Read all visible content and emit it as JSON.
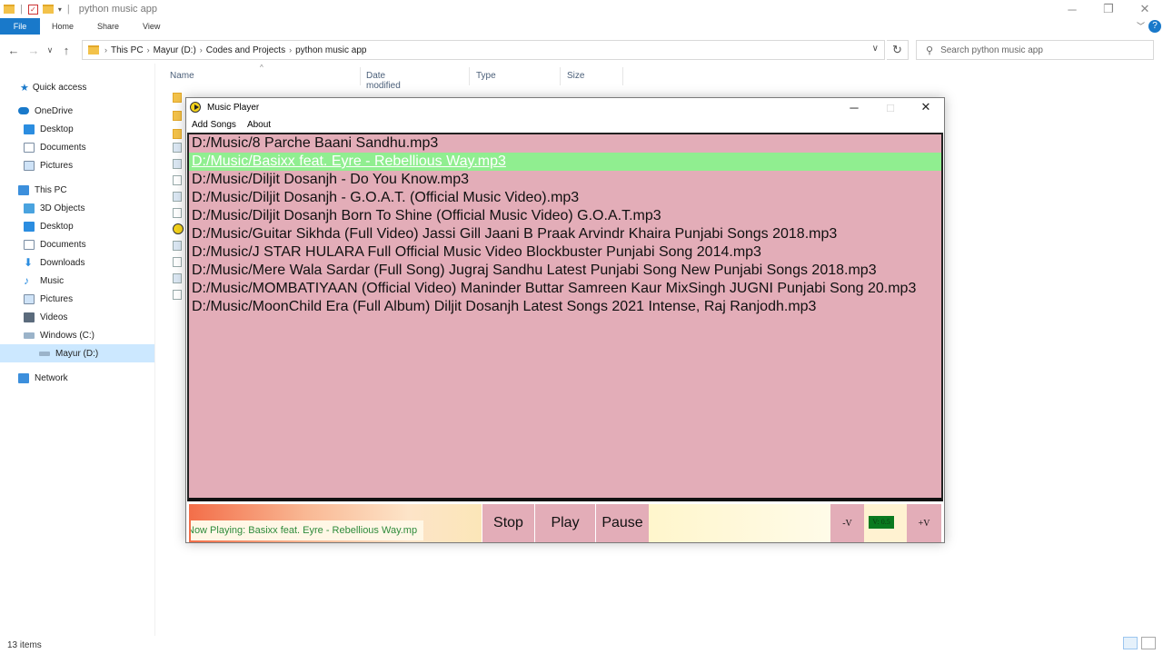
{
  "explorer": {
    "title": "python music app",
    "ribbon_tabs": [
      "File",
      "Home",
      "Share",
      "View"
    ],
    "breadcrumb": [
      "This PC",
      "Mayur (D:)",
      "Codes and Projects",
      "python music app"
    ],
    "search_placeholder": "Search python music app",
    "columns": [
      "Name",
      "Date modified",
      "Type",
      "Size"
    ],
    "sidebar": {
      "quick_access": "Quick access",
      "onedrive": "OneDrive",
      "onedrive_children": [
        "Desktop",
        "Documents",
        "Pictures"
      ],
      "this_pc": "This PC",
      "this_pc_children": [
        "3D Objects",
        "Desktop",
        "Documents",
        "Downloads",
        "Music",
        "Pictures",
        "Videos",
        "Windows (C:)",
        "Mayur (D:)"
      ],
      "network": "Network"
    },
    "status": "13 items",
    "help": "?"
  },
  "player": {
    "title": "Music Player",
    "menu": [
      "Add Songs",
      "About"
    ],
    "songs": [
      "D:/Music/8 Parche Baani Sandhu.mp3",
      "D:/Music/Basixx feat. Eyre - Rebellious Way.mp3",
      "D:/Music/Diljit Dosanjh - Do You Know.mp3",
      "D:/Music/Diljit Dosanjh - G.O.A.T. (Official Music Video).mp3",
      "D:/Music/Diljit Dosanjh Born To Shine (Official Music Video) G.O.A.T.mp3",
      "D:/Music/Guitar Sikhda (Full Video) Jassi Gill Jaani B Praak Arvindr Khaira Punjabi Songs 2018.mp3",
      "D:/Music/J STAR HULARA Full Official Music Video Blockbuster Punjabi Song 2014.mp3",
      "D:/Music/Mere Wala Sardar (Full Song) Jugraj Sandhu Latest Punjabi Song New Punjabi Songs 2018.mp3",
      "D:/Music/MOMBATIYAAN (Official Video) Maninder Buttar Samreen Kaur MixSingh JUGNI Punjabi Song 20.mp3",
      "D:/Music/MoonChild Era (Full Album) Diljit Dosanjh Latest Songs 2021 Intense, Raj Ranjodh.mp3"
    ],
    "selected_index": 1,
    "now_playing": "Now Playing: Basixx feat. Eyre - Rebellious Way.mp",
    "buttons": {
      "stop": "Stop",
      "play": "Play",
      "pause": "Pause",
      "vol_down": "-V",
      "vol_up": "+V"
    },
    "volume_label": "V: 0.5",
    "colors": {
      "playlist_bg": "#e3adb8",
      "selected_bg": "#90ee90",
      "now_playing_text": "#2e8b3b"
    }
  }
}
